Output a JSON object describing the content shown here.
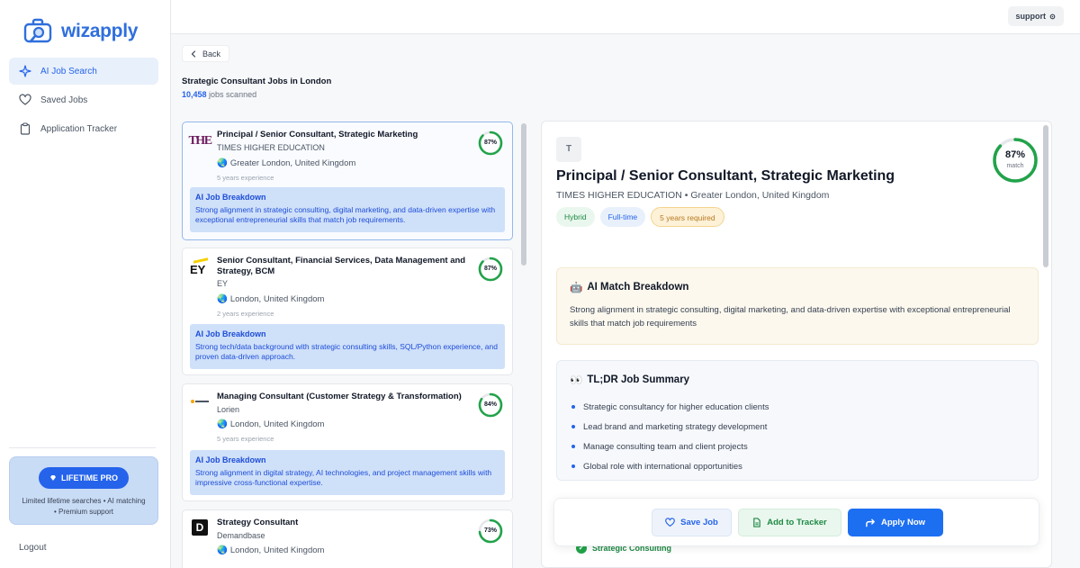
{
  "app": {
    "name": "wizapply",
    "brand_color": "#2f6fdc"
  },
  "sidebar": {
    "items": [
      {
        "label": "AI Job Search",
        "icon": "sparkle-icon",
        "active": true
      },
      {
        "label": "Saved Jobs",
        "icon": "heart-icon",
        "active": false
      },
      {
        "label": "Application Tracker",
        "icon": "clipboard-icon",
        "active": false
      }
    ],
    "promo": {
      "badge": "LIFETIME PRO",
      "text": "Limited lifetime searches • AI matching • Premium support"
    },
    "logout": "Logout"
  },
  "topbar": {
    "support": "support"
  },
  "header": {
    "back": "Back",
    "title": "Strategic Consultant Jobs in London",
    "scanned_count": "10,458",
    "scanned_label": "jobs scanned"
  },
  "jobs": [
    {
      "title": "Principal / Senior Consultant, Strategic Marketing",
      "company": "TIMES HIGHER EDUCATION",
      "location": "Greater London, United Kingdom",
      "experience": "5 years experience",
      "match": 87,
      "match_label": "87%",
      "breakdown_title": "AI Job Breakdown",
      "breakdown_text": "Strong alignment in strategic consulting, digital marketing, and data-driven expertise with exceptional entrepreneurial skills that match job requirements.",
      "logo_text": "THE",
      "selected": true
    },
    {
      "title": "Senior Consultant, Financial Services, Data Management and Strategy, BCM",
      "company": "EY",
      "location": "London, United Kingdom",
      "experience": "2 years experience",
      "match": 87,
      "match_label": "87%",
      "breakdown_title": "AI Job Breakdown",
      "breakdown_text": "Strong tech/data background with strategic consulting skills, SQL/Python experience, and proven data-driven approach.",
      "logo_text": "EY",
      "selected": false
    },
    {
      "title": "Managing Consultant (Customer Strategy & Transformation)",
      "company": "Lorien",
      "location": "London, United Kingdom",
      "experience": "5 years experience",
      "match": 84,
      "match_label": "84%",
      "breakdown_title": "AI Job Breakdown",
      "breakdown_text": "Strong alignment in digital strategy, AI technologies, and project management skills with impressive cross-functional expertise.",
      "logo_text": "",
      "selected": false
    },
    {
      "title": "Strategy Consultant",
      "company": "Demandbase",
      "location": "London, United Kingdom",
      "experience": "",
      "match": 73,
      "match_label": "73%",
      "breakdown_title": "",
      "breakdown_text": "",
      "logo_text": "D",
      "selected": false
    }
  ],
  "detail": {
    "logo_letter": "T",
    "title": "Principal / Senior Consultant, Strategic Marketing",
    "subtitle": "TIMES HIGHER EDUCATION • Greater London, United Kingdom",
    "tags": [
      "Hybrid",
      "Full-time",
      "5 years required"
    ],
    "match": 87,
    "match_pct": "87%",
    "match_word": "match",
    "ai_match": {
      "emoji": "🤖",
      "title": "AI Match Breakdown",
      "text": "Strong alignment in strategic consulting, digital marketing, and data-driven expertise with exceptional entrepreneurial skills that match job requirements"
    },
    "tldr": {
      "emoji": "👀",
      "title": "TL;DR Job Summary",
      "items": [
        "Strategic consultancy for higher education clients",
        "Lead brand and marketing strategy development",
        "Manage consulting team and client projects",
        "Global role with international opportunities"
      ]
    },
    "peek_item": "Strategic Consulting"
  },
  "actions": {
    "save": "Save Job",
    "track": "Add to Tracker",
    "apply": "Apply Now"
  }
}
